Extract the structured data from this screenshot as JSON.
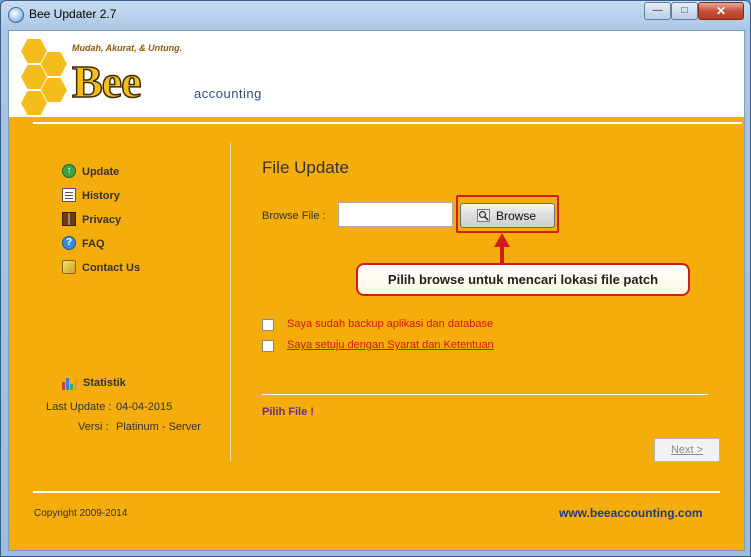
{
  "window": {
    "title": "Bee Updater 2.7"
  },
  "brand": {
    "tagline": "Mudah, Akurat, & Untung.",
    "logo_word": "Bee",
    "logo_sub": "accounting"
  },
  "nav": {
    "items": [
      {
        "label": "Update",
        "icon": "update-icon"
      },
      {
        "label": "History",
        "icon": "history-icon"
      },
      {
        "label": "Privacy",
        "icon": "privacy-icon"
      },
      {
        "label": "FAQ",
        "icon": "faq-icon"
      },
      {
        "label": "Contact Us",
        "icon": "contact-icon"
      }
    ]
  },
  "stats": {
    "label": "Statistik",
    "last_update_label": "Last Update :",
    "last_update_value": "04-04-2015",
    "version_label": "Versi :",
    "version_value": "Platinum - Server"
  },
  "content": {
    "title": "File Update",
    "browse_label": "Browse File :",
    "browse_value": "",
    "browse_button": "Browse",
    "callout": "Pilih browse untuk mencari lokasi file patch",
    "checkbox_backup": "Saya sudah backup aplikasi dan database",
    "checkbox_terms": "Saya setuju dengan Syarat dan Ketentuan",
    "status": "Pilih File !",
    "next_button": "Next >"
  },
  "footer": {
    "copyright": "Copyright 2009-2014",
    "website": "www.beeaccounting.com"
  },
  "colors": {
    "background": "#f5ad0c",
    "accent_red": "#d21c1c",
    "link_blue": "#1f3a8a"
  }
}
